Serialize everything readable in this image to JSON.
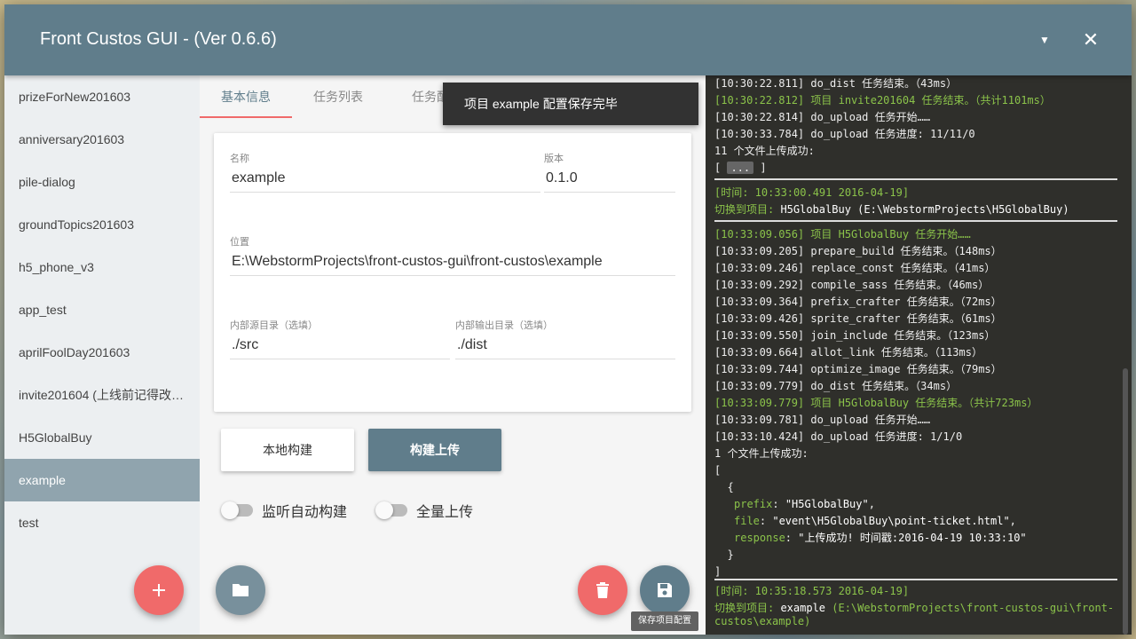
{
  "window": {
    "title": "Front Custos GUI - (Ver 0.6.6)"
  },
  "sidebar": {
    "items": [
      {
        "label": "prizeForNew201603"
      },
      {
        "label": "anniversary201603"
      },
      {
        "label": "pile-dialog"
      },
      {
        "label": "groundTopics201603"
      },
      {
        "label": "h5_phone_v3"
      },
      {
        "label": "app_test"
      },
      {
        "label": "aprilFoolDay201603"
      },
      {
        "label": "invite201604 (上线前记得改…"
      },
      {
        "label": "H5GlobalBuy"
      },
      {
        "label": "example",
        "active": true
      },
      {
        "label": "test"
      }
    ],
    "add_icon": "plus-icon"
  },
  "tabs": [
    {
      "label": "基本信息",
      "active": true
    },
    {
      "label": "任务列表"
    },
    {
      "label": "任务配"
    }
  ],
  "form": {
    "name_label": "名称",
    "name_value": "example",
    "version_label": "版本",
    "version_value": "0.1.0",
    "location_label": "位置",
    "location_value": "E:\\WebstormProjects\\front-custos-gui\\front-custos\\example",
    "src_label": "内部源目录（选填）",
    "src_value": "./src",
    "dist_label": "内部输出目录（选填）",
    "dist_value": "./dist"
  },
  "actions": {
    "local_build": "本地构建",
    "build_upload": "构建上传",
    "watch_label": "监听自动构建",
    "full_upload_label": "全量上传",
    "watch_on": false,
    "full_upload_on": false
  },
  "toast": "项目 example 配置保存完毕",
  "tooltip": "保存项目配置",
  "log": {
    "lines": [
      {
        "t": "[10:30:22.811] do_dist 任务结束。（43ms）",
        "c": ""
      },
      {
        "t": "[10:30:22.812] 项目 invite201604 任务结束。（共计1101ms）",
        "c": "green"
      },
      {
        "t": "[10:30:22.814] do_upload 任务开始……",
        "c": ""
      },
      {
        "t": "[10:30:33.784] do_upload 任务进度: 11/11/0",
        "c": ""
      },
      {
        "t": "11 个文件上传成功:",
        "c": ""
      },
      {
        "t": "[10:33:09.056] 项目 H5GlobalBuy 任务开始……",
        "c": "green"
      },
      {
        "t": "[10:33:09.205] prepare_build 任务结束。（148ms）",
        "c": ""
      },
      {
        "t": "[10:33:09.246] replace_const 任务结束。（41ms）",
        "c": ""
      },
      {
        "t": "[10:33:09.292] compile_sass 任务结束。（46ms）",
        "c": ""
      },
      {
        "t": "[10:33:09.364] prefix_crafter 任务结束。（72ms）",
        "c": ""
      },
      {
        "t": "[10:33:09.426] sprite_crafter 任务结束。（61ms）",
        "c": ""
      },
      {
        "t": "[10:33:09.550] join_include 任务结束。（123ms）",
        "c": ""
      },
      {
        "t": "[10:33:09.664] allot_link 任务结束。（113ms）",
        "c": ""
      },
      {
        "t": "[10:33:09.744] optimize_image 任务结束。（79ms）",
        "c": ""
      },
      {
        "t": "[10:33:09.779] do_dist 任务结束。（34ms）",
        "c": ""
      },
      {
        "t": "[10:33:09.779] 项目 H5GlobalBuy 任务结束。（共计723ms）",
        "c": "green"
      },
      {
        "t": "[10:33:09.781] do_upload 任务开始……",
        "c": ""
      },
      {
        "t": "[10:33:10.424] do_upload 任务进度: 1/1/0",
        "c": ""
      },
      {
        "t": "1 个文件上传成功:",
        "c": ""
      },
      {
        "t": "[",
        "c": ""
      },
      {
        "t": "  {",
        "c": ""
      },
      {
        "t": "  }",
        "c": ""
      },
      {
        "t": "]",
        "c": ""
      }
    ],
    "collapsed_open": "[ ",
    "collapsed_dots": "...",
    "collapsed_close": " ]",
    "switch1_time": "[时间: 10:33:00.491 2016-04-19]",
    "switch1_prefix": "切换到项目: ",
    "switch1_name": "H5GlobalBuy",
    "switch1_path": " (E:\\WebstormProjects\\H5GlobalBuy)",
    "obj": {
      "prefix_key": "prefix",
      "prefix_val": "\"H5GlobalBuy\"",
      "file_key": "file",
      "file_val": "\"event\\H5GlobalBuy\\point-ticket.html\"",
      "response_key": "response",
      "response_val": "\"上传成功! 时间戳:2016-04-19 10:33:10\""
    },
    "switch2_time": "[时间: 10:35:18.573 2016-04-19]",
    "switch2_prefix": "切换到项目: ",
    "switch2_name": "example",
    "switch2_path_1": " (E:\\WebstormProjects\\front-custos-gui\\front-",
    "switch2_path_2": "custos\\example)"
  }
}
